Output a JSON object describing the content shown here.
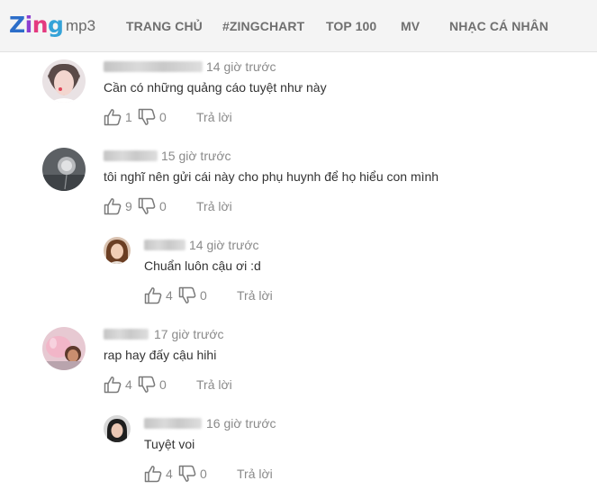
{
  "app": {
    "logo_text": "Zing",
    "logo_suffix": "mp3"
  },
  "nav": {
    "items": [
      "TRANG CHỦ",
      "#ZINGCHART",
      "TOP 100",
      "MV",
      "NHẠC CÁ NHÂN"
    ]
  },
  "comments": [
    {
      "time": "14 giờ trước",
      "text": "Cần có những quảng cáo tuyệt như này",
      "likes": "1",
      "dislikes": "0",
      "reply": "Trả lời"
    },
    {
      "time": "15 giờ trước",
      "text": "tôi nghĩ nên gửi cái này cho phụ huynh để họ hiểu con mình",
      "likes": "9",
      "dislikes": "0",
      "reply": "Trả lời"
    },
    {
      "time": "14 giờ trước",
      "text": "Chuẩn luôn cậu ơi :d",
      "likes": "4",
      "dislikes": "0",
      "reply": "Trả lời"
    },
    {
      "time": "17 giờ trước",
      "text": "rap hay đấy cậu hihi",
      "likes": "4",
      "dislikes": "0",
      "reply": "Trả lời"
    },
    {
      "time": "16 giờ trước",
      "text": "Tuyệt voi",
      "likes": "4",
      "dislikes": "0",
      "reply": "Trả lời"
    }
  ],
  "colors": {
    "nav_bg": "#f4f4f4",
    "nav_text": "#6f6f6f",
    "meta_text": "#8a8a8a",
    "body_text": "#333333"
  }
}
